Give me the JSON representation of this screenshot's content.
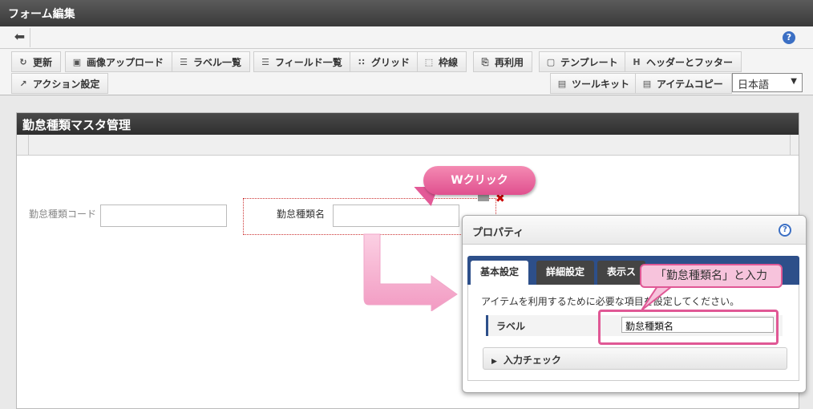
{
  "window": {
    "title": "フォーム編集"
  },
  "nav": {
    "back_icon": "arrow-left-icon",
    "help_label": "?"
  },
  "toolbar": {
    "items": [
      {
        "label": "更新",
        "icon": "refresh-icon"
      },
      {
        "label": "画像アップロード",
        "icon": "image-upload-icon"
      },
      {
        "label": "ラベル一覧",
        "icon": "label-list-icon"
      },
      {
        "label": "フィールド一覧",
        "icon": "field-list-icon"
      },
      {
        "label": "グリッド",
        "icon": "grid-icon"
      },
      {
        "label": "枠線",
        "icon": "border-icon"
      },
      {
        "label": "再利用",
        "icon": "reuse-icon"
      },
      {
        "label": "テンプレート",
        "icon": "template-icon"
      },
      {
        "label": "ヘッダーとフッター",
        "icon": "header-footer-icon"
      },
      {
        "label": "アクション設定",
        "icon": "action-icon"
      },
      {
        "label": "ツールキット",
        "icon": "toolkit-icon"
      },
      {
        "label": "アイテムコピー",
        "icon": "item-copy-icon"
      }
    ],
    "language": "日本語"
  },
  "form": {
    "title": "勤怠種類マスタ管理",
    "fields": [
      {
        "label": "勤怠種類コード",
        "value": ""
      },
      {
        "label": "勤怠種類名",
        "value": ""
      }
    ]
  },
  "annotations": {
    "double_click": "Wクリック",
    "enter_hint": "「勤怠種類名」と入力"
  },
  "panel": {
    "title": "プロパティ",
    "help_label": "?",
    "tabs": [
      "基本設定",
      "詳細設定",
      "表示ス"
    ],
    "description": "アイテムを利用するために必要な項目を設定してください。",
    "label_caption": "ラベル",
    "label_value": "勤怠種類名",
    "input_check": "入力チェック"
  },
  "colors": {
    "accent_pink": "#e05895",
    "tab_blue": "#2d4f8a"
  }
}
